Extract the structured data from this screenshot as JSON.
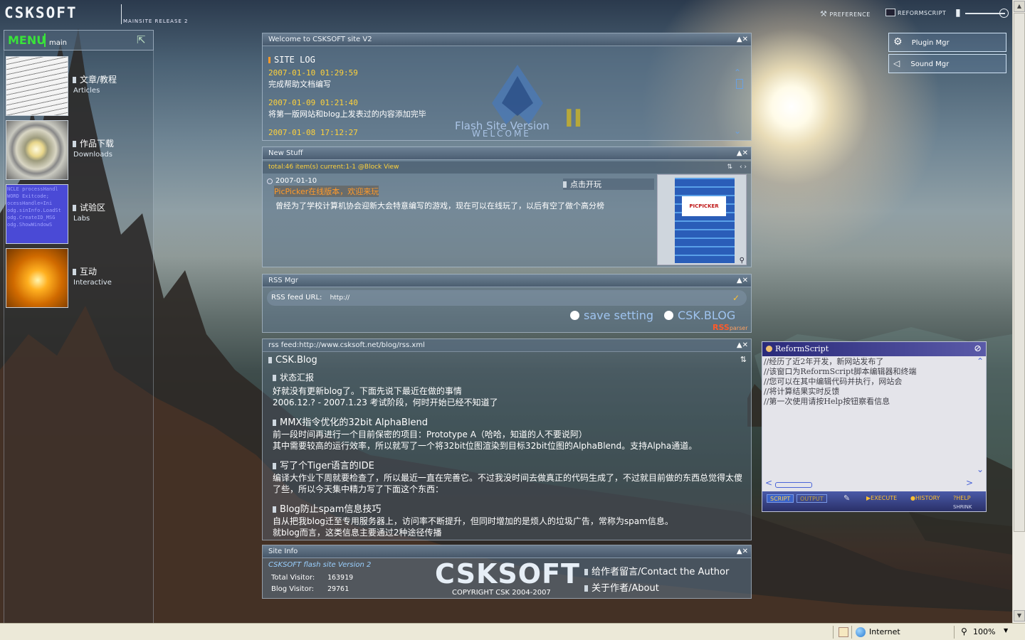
{
  "brand": {
    "logo": "CSKSOFT",
    "subtitle": "MAINSITE RELEASE 2"
  },
  "topbar": {
    "preference": "PREFERENCE",
    "reformscript": "REFORMSCRIPT"
  },
  "menu": {
    "title": "MENU",
    "section": "main",
    "items": [
      {
        "cn": "文章/教程",
        "en": "Articles",
        "thumb_text": "",
        "icon": "document-thumbnail"
      },
      {
        "cn": "作品下载",
        "en": "Downloads",
        "thumb_text": "",
        "icon": "disc-thumbnail"
      },
      {
        "cn": "试验区",
        "en": "Labs",
        "thumb_text": "NCLE processHandl\nWORD Exitcode;\nocessHandle=Ini\nodg.sinInfo.LoadSt\nodg.CreateID_MSG\nodg.ShowWindowS",
        "icon": "code-thumbnail"
      },
      {
        "cn": "互动",
        "en": "Interactive",
        "thumb_text": "",
        "icon": "light-thumbnail"
      }
    ]
  },
  "welcome": {
    "title": "Welcome to CSKSOFT site V2",
    "log_title": "SITE LOG",
    "entries": [
      {
        "date": "2007-01-10 01:29:59",
        "text": "完成帮助文档编写"
      },
      {
        "date": "2007-01-09 01:21:40",
        "text": "将第一版网站和blog上发表过的内容添加完毕"
      },
      {
        "date": "2007-01-08 17:12:27",
        "text": ""
      }
    ],
    "flash_line1": "Flash Site Version",
    "flash_line2": "WELCOME",
    "flash_ver": "II"
  },
  "newstuff": {
    "title": "New Stuff",
    "status": "total:46 item(s) current:1-1 @Block View",
    "date": "2007-01-10",
    "headline": "PicPicker在线版本，欢迎来玩",
    "play": "点击开玩",
    "body": "曾经为了学校计算机协会迎新大会特意编写的游戏，现在可以在线玩了，以后有空了做个高分榜",
    "thumb_logo": "PICPICKER"
  },
  "rss_mgr": {
    "title": "RSS Mgr",
    "label": "RSS feed URL:",
    "url": "http://",
    "save": "save setting",
    "blog": "CSK.BLOG",
    "rss_badge": "RSS",
    "parser": "parser"
  },
  "rss_feed": {
    "title": "rss feed:http://www.csksoft.net/blog/rss.xml",
    "blog": "CSK.Blog",
    "items": [
      {
        "title": "状态汇报",
        "body": "好就没有更新blog了。下面先说下最近在做的事情\n2006.12.? - 2007.1.23 考试阶段，何时开始已经不知道了"
      },
      {
        "title": "MMX指令优化的32bit AlphaBlend",
        "body": "前一段时间再进行一个目前保密的项目：Prototype A（哈哈，知道的人不要说阿）\n其中需要较高的运行效率，所以就写了一个将32bit位图渲染到目标32bit位图的AlphaBlend。支持Alpha通道。"
      },
      {
        "title": "写了个Tiger语言的IDE",
        "body": "编译大作业下周就要检查了，所以最近一直在完善它。不过我没时间去做真正的代码生成了，不过就目前做的东西总觉得太傻了些，所以今天集中精力写了下面这个东西："
      },
      {
        "title": "Blog防止spam信息技巧",
        "body": "自从把我blog迁至专用服务器上，访问率不断提升，但同时增加的是烦人的垃圾广告，常称为spam信息。\n就blog而言，这类信息主要通过2种途径传播"
      }
    ]
  },
  "siteinfo": {
    "title": "Site Info",
    "version": "CSKSOFT flash site Version 2",
    "total_label": "Total Visitor:",
    "total": "163919",
    "blog_label": "Blog Visitor:",
    "blog": "29761",
    "logo": "CSKSOFT",
    "copyright": "COPYRIGHT CSK 2004-2007",
    "contact": "给作者留言/Contact the Author",
    "about": "关于作者/About"
  },
  "mgr_buttons": {
    "plugin": "Plugin Mgr",
    "sound": "Sound Mgr"
  },
  "reformscript": {
    "title": "ReformScript",
    "lines": [
      "//经历了近2年开发，新网站发布了",
      "//该窗口为ReformScript脚本编辑器和终端",
      "//您可以在其中编辑代码并执行，网站会",
      "//将计算结果实时反馈",
      "//第一次使用请按Help按钮察看信息"
    ],
    "tabs": [
      "SCRIPT",
      "OUTPUT"
    ],
    "execute": "EXECUTE",
    "history": "HISTORY",
    "help": "HELP",
    "shrink": "SHRINK"
  },
  "statusbar": {
    "zone": "Internet",
    "zoom": "100%"
  }
}
